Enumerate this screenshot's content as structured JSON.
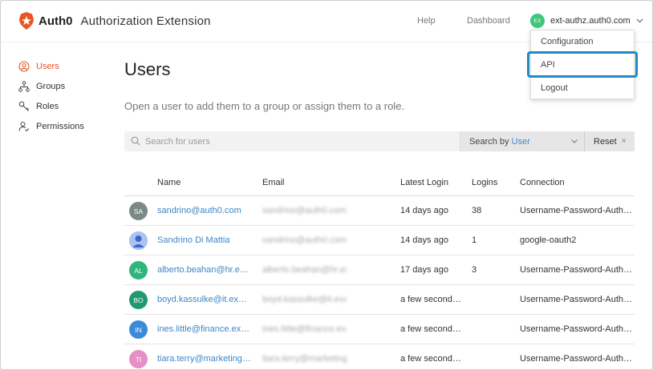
{
  "header": {
    "brand_name": "Auth0",
    "app_title": "Authorization Extension",
    "nav": {
      "help": "Help",
      "dashboard": "Dashboard"
    },
    "user": {
      "initials": "EX",
      "name": "ext-authz.auth0.com"
    }
  },
  "dropdown": {
    "items": [
      {
        "label": "Configuration"
      },
      {
        "label": "API"
      },
      {
        "label": "Logout"
      }
    ]
  },
  "sidebar": {
    "items": [
      {
        "label": "Users",
        "icon": "user-icon",
        "active": true
      },
      {
        "label": "Groups",
        "icon": "groups-icon",
        "active": false
      },
      {
        "label": "Roles",
        "icon": "roles-icon",
        "active": false
      },
      {
        "label": "Permissions",
        "icon": "permissions-icon",
        "active": false
      }
    ]
  },
  "main": {
    "title": "Users",
    "description": "Open a user to add them to a group or assign them to a role.",
    "search": {
      "placeholder": "Search for users",
      "search_by_prefix": "Search by",
      "search_by_value": "User",
      "reset_label": "Reset",
      "reset_icon": "×"
    },
    "table": {
      "headers": {
        "name": "Name",
        "email": "Email",
        "latest_login": "Latest Login",
        "logins": "Logins",
        "connection": "Connection"
      },
      "rows": [
        {
          "avatar": "SA",
          "avatar_color": "#7b8a86",
          "name": "sandrino@auth0.com",
          "email": "sandrino@auth0.com",
          "latest_login": "14 days ago",
          "logins": "38",
          "connection": "Username-Password-Authentication"
        },
        {
          "avatar": "",
          "avatar_color": "#9ab7e8",
          "name": "Sandrino Di Mattia",
          "email": "sandrino@auth0.com",
          "latest_login": "14 days ago",
          "logins": "1",
          "connection": "google-oauth2"
        },
        {
          "avatar": "AL",
          "avatar_color": "#2fb67c",
          "name": "alberto.beahan@hr.example.com",
          "email": "alberto.beahan@hr.example.com",
          "latest_login": "17 days ago",
          "logins": "3",
          "connection": "Username-Password-Authentication"
        },
        {
          "avatar": "BO",
          "avatar_color": "#1f9a6e",
          "name": "boyd.kassulke@it.example.com",
          "email": "boyd.kassulke@it.example.com",
          "latest_login": "a few seconds ago",
          "logins": "",
          "connection": "Username-Password-Authentication"
        },
        {
          "avatar": "IN",
          "avatar_color": "#3b8ad9",
          "name": "ines.little@finance.example.com",
          "email": "ines.little@finance.example.com",
          "latest_login": "a few seconds ago",
          "logins": "",
          "connection": "Username-Password-Authentication"
        },
        {
          "avatar": "TI",
          "avatar_color": "#e58fc6",
          "name": "tiara.terry@marketing.example.com",
          "email": "tiara.terry@marketing.example.com",
          "latest_login": "a few seconds ago",
          "logins": "",
          "connection": "Username-Password-Authentication"
        }
      ]
    }
  },
  "colors": {
    "accent": "#eb5424",
    "link": "#3f86c6",
    "highlight": "#1f8ac6"
  }
}
